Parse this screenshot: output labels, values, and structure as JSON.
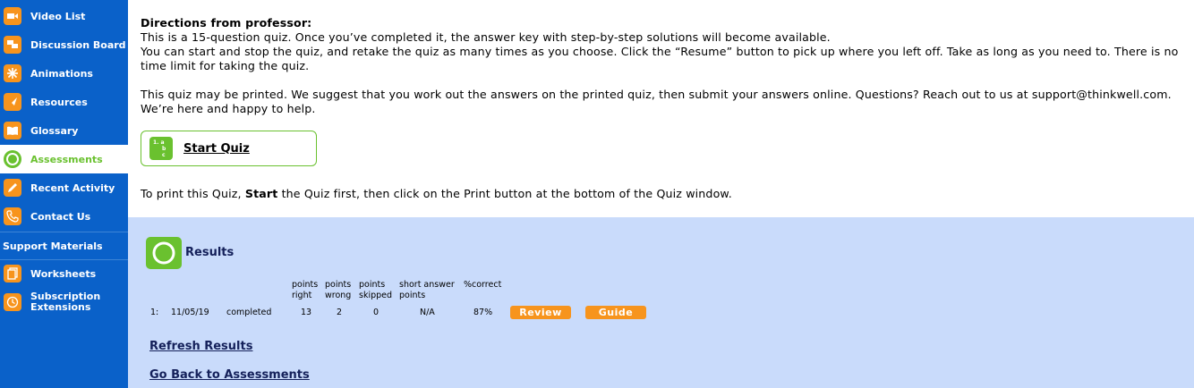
{
  "sidebar": {
    "items": [
      {
        "label": "Video List",
        "icon": "video-icon"
      },
      {
        "label": "Discussion Board",
        "icon": "discussion-icon"
      },
      {
        "label": "Animations",
        "icon": "animation-icon"
      },
      {
        "label": "Resources",
        "icon": "resources-icon"
      },
      {
        "label": "Glossary",
        "icon": "glossary-icon"
      },
      {
        "label": "Assessments",
        "icon": "assessment-icon"
      },
      {
        "label": "Recent Activity",
        "icon": "pencil-icon"
      },
      {
        "label": "Contact Us",
        "icon": "phone-icon"
      }
    ],
    "support_header": "Support Materials",
    "support_items": [
      {
        "label": "Worksheets",
        "icon": "worksheet-icon"
      },
      {
        "label_line1": "Subscription",
        "label_line2": "Extensions",
        "icon": "clock-icon"
      }
    ]
  },
  "directions": {
    "heading": "Directions from professor:",
    "line1": "This is a 15-question quiz. Once you’ve completed it, the answer key with step-by-step solutions will become available.",
    "line2": "You can start and stop the quiz, and retake the quiz as many times as you choose. Click the “Resume” button to pick up where you left off. Take as long as you need to. There is no time limit for taking the quiz.",
    "line3": "This quiz may be printed. We suggest that you work out the answers on the printed quiz, then submit your answers online. Questions? Reach out to us at support@thinkwell.com. We’re here and happy to help."
  },
  "start_quiz": {
    "label": "Start Quiz",
    "icon_text": [
      "1. a",
      "b",
      "c"
    ]
  },
  "print_note": {
    "before": "To print this Quiz, ",
    "bold": "Start",
    "after": " the Quiz first, then click on the Print button at the bottom of the Quiz window."
  },
  "results": {
    "title": "Results",
    "columns": [
      {
        "line1": "points",
        "line2": "right"
      },
      {
        "line1": "points",
        "line2": "wrong"
      },
      {
        "line1": "points",
        "line2": "skipped"
      },
      {
        "line1": "short answer",
        "line2": "points"
      },
      {
        "line1": "%correct",
        "line2": ""
      }
    ],
    "row": {
      "index": "1:",
      "date": "11/05/19",
      "status": "completed",
      "right": "13",
      "wrong": "2",
      "skipped": "0",
      "short_answer": "N/A",
      "percent": "87%"
    },
    "review_label": "Review",
    "guide_label": "Guide",
    "refresh_label": "Refresh Results",
    "back_label": "Go Back to Assessments"
  },
  "colors": {
    "sidebar": "#0a61c9",
    "accent_green": "#6ac12f",
    "accent_orange": "#f7941d",
    "results_bg": "#c9dbfb"
  }
}
